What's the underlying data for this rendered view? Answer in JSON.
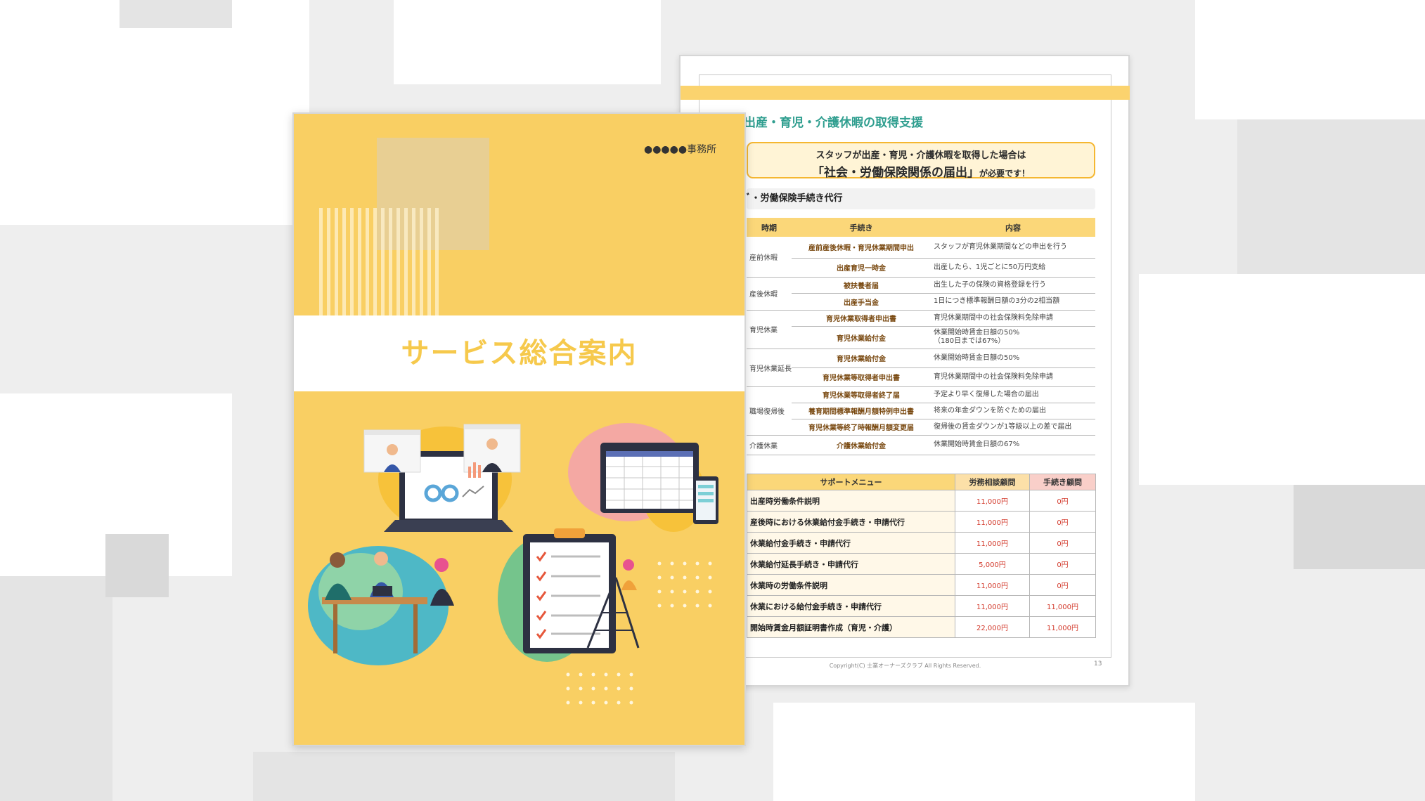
{
  "document_page": {
    "heading": "出産・育児・介護休暇の取得支援",
    "callout": {
      "line1": "スタッフが出産・育児・介護休暇を取得した場合は",
      "line2_main": "「社会・労働保険関係の届出」",
      "line2_tail": "が必要です！"
    },
    "section_title": "ﾞ・労働保険手続き代行",
    "procedure_table": {
      "headers": [
        "時期",
        "手続き",
        "内容"
      ],
      "groups": [
        {
          "period": "産前休暇",
          "rows": [
            {
              "procedure": "産前産後休暇・育児休業期間申出",
              "content": "スタッフが育児休業期間などの申出を行う"
            },
            {
              "procedure": "出産育児一時金",
              "content": "出産したら、1児ごとに50万円支給"
            }
          ]
        },
        {
          "period": "産後休暇",
          "rows": [
            {
              "procedure": "被扶養者届",
              "content": "出生した子の保険の資格登録を行う"
            },
            {
              "procedure": "出産手当金",
              "content": "1日につき標準報酬日額の3分の2相当額"
            }
          ]
        },
        {
          "period": "育児休業",
          "rows": [
            {
              "procedure": "育児休業取得者申出書",
              "content": "育児休業期間中の社会保険料免除申請"
            },
            {
              "procedure": "育児休業給付金",
              "content": "休業開始時賃金日額の50%\n（180日までは67%）"
            }
          ]
        },
        {
          "period": "育児休業延長",
          "rows": [
            {
              "procedure": "育児休業給付金",
              "content": "休業開始時賃金日額の50%"
            },
            {
              "procedure": "育児休業等取得者申出書",
              "content": "育児休業期間中の社会保険料免除申請"
            }
          ]
        },
        {
          "period": "職場復帰後",
          "rows": [
            {
              "procedure": "育児休業等取得者終了届",
              "content": "予定より早く復帰した場合の届出"
            },
            {
              "procedure": "養育期間標準報酬月額特例申出書",
              "content": "将来の年金ダウンを防ぐための届出"
            },
            {
              "procedure": "育児休業等終了時報酬月額変更届",
              "content": "復帰後の賃金ダウンが1等級以上の差で届出"
            }
          ]
        },
        {
          "period": "介護休業",
          "rows": [
            {
              "procedure": "介護休業給付金",
              "content": "休業開始時賃金日額の67%"
            }
          ]
        }
      ]
    },
    "menu_table": {
      "headers": [
        "サポートメニュー",
        "労務相談顧問",
        "手続き顧問"
      ],
      "rows": [
        {
          "item": "出産時労働条件説明",
          "labor": "11,000円",
          "procedure": "0円"
        },
        {
          "item": "産後時における休業給付金手続き・申請代行",
          "labor": "11,000円",
          "procedure": "0円"
        },
        {
          "item": "休業給付金手続き・申請代行",
          "labor": "11,000円",
          "procedure": "0円"
        },
        {
          "item": "休業給付延長手続き・申請代行",
          "labor": "5,000円",
          "procedure": "0円"
        },
        {
          "item": "休業時の労働条件説明",
          "labor": "11,000円",
          "procedure": "0円"
        },
        {
          "item": "休業における給付金手続き・申請代行",
          "labor": "11,000円",
          "procedure": "11,000円"
        },
        {
          "item": "開始時賃金月額証明書作成（育児・介護）",
          "labor": "22,000円",
          "procedure": "11,000円"
        }
      ]
    },
    "copyright": "Copyright(C) 士業オーナーズクラブ All Rights Reserved.",
    "page_number": "13"
  },
  "cover_page": {
    "office_name": "●●●●●事務所",
    "title": "サービス総合案内"
  },
  "colors": {
    "cover_yellow": "#f9cf63",
    "title_yellow": "#f6c94c",
    "heading_teal": "#2f9e8f",
    "price_red": "#d33a2c"
  }
}
